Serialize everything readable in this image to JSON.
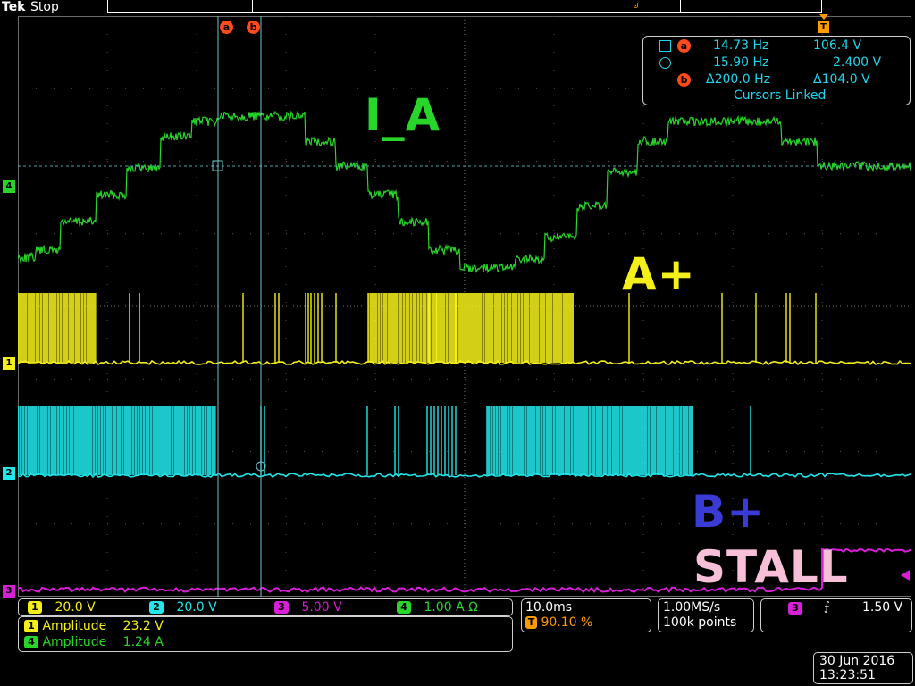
{
  "header": {
    "brand": "Tek",
    "run_state": "Stop"
  },
  "cursors": {
    "a_label": "a",
    "b_label": "b",
    "trigger_label": "T",
    "readouts": [
      {
        "label": "a",
        "freq": "14.73 Hz",
        "volt": "106.4 V"
      },
      {
        "label": "",
        "freq": "15.90 Hz",
        "volt": "2.400 V"
      },
      {
        "label": "b",
        "freq": "Δ200.0 Hz",
        "volt": "Δ104.0 V"
      }
    ],
    "linked": "Cursors Linked"
  },
  "trace_labels": {
    "ia": "I_A",
    "aplus": "A+",
    "bplus": "B+",
    "stall": "STALL"
  },
  "channel_markers": [
    "4",
    "1",
    "2",
    "3"
  ],
  "colors": {
    "ch1": "#f4ef1a",
    "ch2": "#21e6ea",
    "ch3": "#d61fd6",
    "ch4": "#28d62a",
    "bplus_label": "#3a3ad4",
    "stall_label": "#f7c0d8",
    "cursor": "#ff4a1c",
    "trigger": "#ff9a00"
  },
  "channels": [
    {
      "num": "1",
      "scale": "20.0 V"
    },
    {
      "num": "2",
      "scale": "20.0 V"
    },
    {
      "num": "3",
      "scale": "5.00 V"
    },
    {
      "num": "4",
      "scale": "1.00 A Ω"
    }
  ],
  "measurements": [
    {
      "ch": "1",
      "name": "Amplitude",
      "value": "23.2 V"
    },
    {
      "ch": "4",
      "name": "Amplitude",
      "value": "1.24 A"
    }
  ],
  "timebase": {
    "scale": "10.0ms",
    "trigger_badge": "T",
    "trigger_pos": "90.10 %"
  },
  "acquisition": {
    "rate": "1.00MS/s",
    "points": "100k points"
  },
  "trigger": {
    "ch": "3",
    "slope": "∠",
    "level": "1.50 V"
  },
  "datetime": {
    "date": "30 Jun 2016",
    "time": "13:23:51"
  }
}
